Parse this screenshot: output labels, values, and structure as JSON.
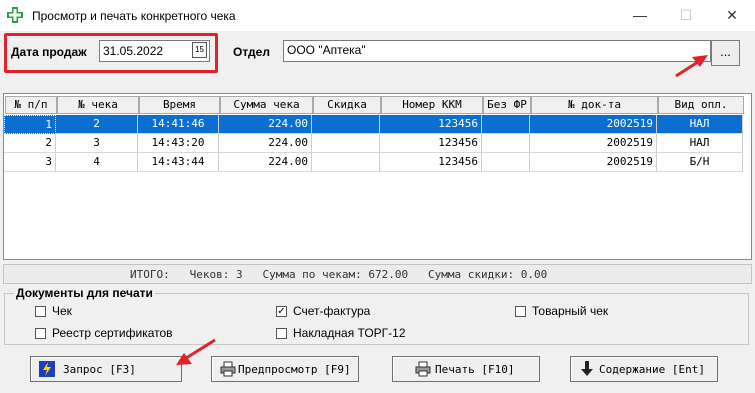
{
  "window": {
    "title": "Просмотр и печать конкретного чека",
    "controls": {
      "minimize": "—",
      "maximize": "☐",
      "close": "✕"
    }
  },
  "filters": {
    "date_label": "Дата продаж",
    "date_value": "31.05.2022",
    "calendar_glyph": "15",
    "dept_label": "Отдел",
    "dept_value": "ООО \"Аптека\"",
    "dept_button": "..."
  },
  "table": {
    "columns": [
      "№ п/п",
      "№ чека",
      "Время",
      "Сумма чека",
      "Скидка",
      "Номер ККМ",
      "Без ФР",
      "№ док-та",
      "Вид опл."
    ],
    "rows": [
      [
        "1",
        "2",
        "14:41:46",
        "224.00",
        "",
        "123456",
        "",
        "2002519",
        "НАЛ"
      ],
      [
        "2",
        "3",
        "14:43:20",
        "224.00",
        "",
        "123456",
        "",
        "2002519",
        "НАЛ"
      ],
      [
        "3",
        "4",
        "14:43:44",
        "224.00",
        "",
        "123456",
        "",
        "2002519",
        "Б/Н"
      ]
    ],
    "selected_row": 0
  },
  "totals": "ИТОГО:   Чеков: 3   Сумма по чекам: 672.00   Сумма скидки: 0.00",
  "documents": {
    "title": "Документы для печати",
    "options": [
      {
        "label": "Чек",
        "checked": false
      },
      {
        "label": "Счет-фактура",
        "checked": true
      },
      {
        "label": "Товарный чек",
        "checked": false
      },
      {
        "label": "Реестр сертификатов",
        "checked": false
      },
      {
        "label": "Накладная ТОРГ-12",
        "checked": false
      }
    ]
  },
  "buttons": {
    "query": "Запрос [F3]",
    "preview": "Предпросмотр [F9]",
    "print": "Печать [F10]",
    "content": "Содержание [Ent]"
  },
  "colors": {
    "highlight": "#e0222c",
    "selection": "#0a6fd1",
    "arrow": "#e0222c",
    "app_icon": "#2e9e3a"
  }
}
